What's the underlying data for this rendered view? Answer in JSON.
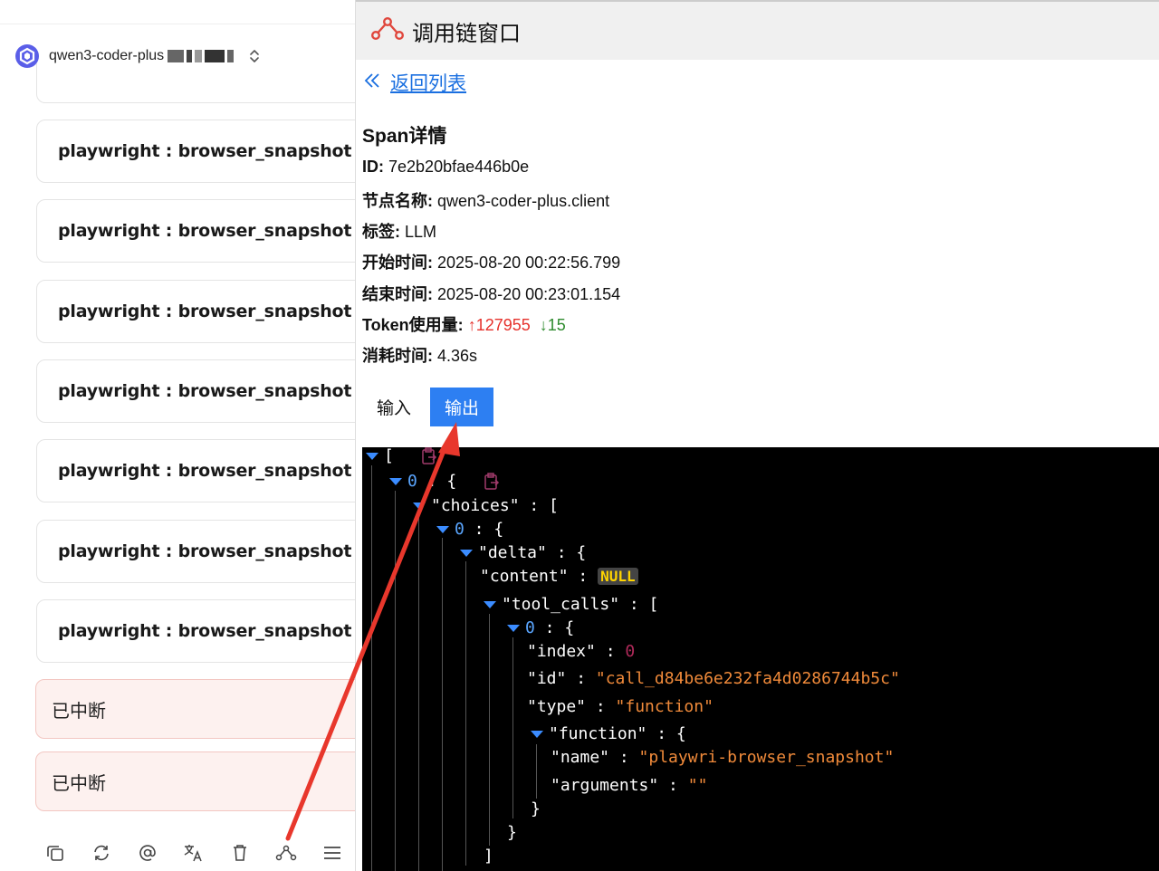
{
  "model": {
    "name": "qwen3-coder-plus"
  },
  "cards": [
    {
      "label": "playwright : browser_snapshot"
    },
    {
      "label": "playwright : browser_snapshot"
    },
    {
      "label": "playwright : browser_snapshot"
    },
    {
      "label": "playwright : browser_snapshot"
    },
    {
      "label": "playwright : browser_snapshot"
    },
    {
      "label": "playwright : browser_snapshot"
    },
    {
      "label": "playwright : browser_snapshot"
    }
  ],
  "stopped": [
    {
      "label": "已中断"
    },
    {
      "label": "已中断"
    }
  ],
  "toolbar": {
    "icons": [
      "copy-icon",
      "refresh-icon",
      "at-icon",
      "translate-icon",
      "trash-icon",
      "trace-icon",
      "menu-icon"
    ]
  },
  "panel": {
    "title": "调用链窗口",
    "back": "返回列表",
    "span_title": "Span详情",
    "fields": {
      "id_label": "ID:",
      "id_value": "7e2b20bfae446b0e",
      "node_label": "节点名称:",
      "node_value": "qwen3-coder-plus.client",
      "tag_label": "标签:",
      "tag_value": "LLM",
      "start_label": "开始时间:",
      "start_value": "2025-08-20 00:22:56.799",
      "end_label": "结束时间:",
      "end_value": "2025-08-20 00:23:01.154",
      "token_label": "Token使用量:",
      "token_up": "↑127955",
      "token_down": "↓15",
      "cost_label": "消耗时间:",
      "cost_value": "4.36s"
    },
    "tabs": {
      "input": "输入",
      "output": "输出"
    }
  },
  "json_view": {
    "l1": "[",
    "l2_idx": "0",
    "l2_rest": " : {",
    "l3_key": "\"choices\"",
    "l3_rest": " : [",
    "l4_idx": "0",
    "l4_rest": " : {",
    "l5_key": "\"delta\"",
    "l5_rest": " : {",
    "l6_key": "\"content\"",
    "l6_sep": " : ",
    "l6_val": "NULL",
    "l7_key": "\"tool_calls\"",
    "l7_rest": " : [",
    "l8_idx": "0",
    "l8_rest": " : {",
    "l9_key": "\"index\"",
    "l9_sep": " : ",
    "l9_val": "0",
    "l10_key": "\"id\"",
    "l10_sep": " : ",
    "l10_val": "\"call_d84be6e232fa4d0286744b5c\"",
    "l11_key": "\"type\"",
    "l11_sep": " : ",
    "l11_val": "\"function\"",
    "l12_key": "\"function\"",
    "l12_rest": " : {",
    "l13_key": "\"name\"",
    "l13_sep": " : ",
    "l13_val": "\"playwri-browser_snapshot\"",
    "l14_key": "\"arguments\"",
    "l14_sep": " : ",
    "l14_val": "\"\"",
    "l15": "}",
    "l16": "}",
    "l17": "]"
  },
  "colors": {
    "accent": "#2d7ff2",
    "link": "#1a6fe0",
    "arrow": "#e8372c",
    "stopped_bg": "#fdf1ef",
    "shield": "#3aa76d"
  }
}
